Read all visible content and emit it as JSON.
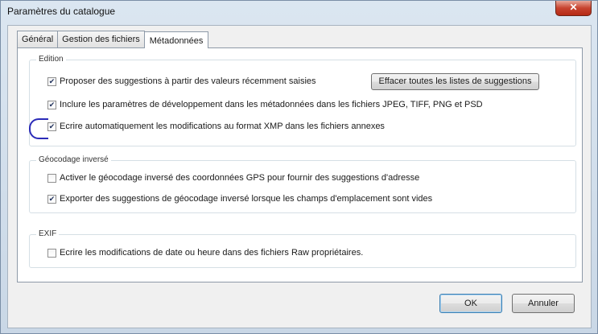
{
  "window": {
    "title": "Paramètres du catalogue",
    "close_label": "✕"
  },
  "tabs": [
    {
      "label": "Général"
    },
    {
      "label": "Gestion des fichiers"
    },
    {
      "label": "Métadonnées"
    }
  ],
  "sections": {
    "edition": {
      "legend": "Edition",
      "items": [
        {
          "label": "Proposer des suggestions à partir des valeurs récemment saisies",
          "checked": true
        },
        {
          "label": "Inclure les paramètres de développement dans les métadonnées dans les fichiers JPEG, TIFF, PNG et PSD",
          "checked": true
        },
        {
          "label": "Ecrire automatiquement les modifications au format XMP dans les fichiers annexes",
          "checked": true
        }
      ],
      "clear_button": "Effacer toutes les listes de suggestions"
    },
    "geocoding": {
      "legend": "Géocodage inversé",
      "items": [
        {
          "label": "Activer le géocodage inversé des coordonnées GPS pour fournir des suggestions d'adresse",
          "checked": false
        },
        {
          "label": "Exporter des suggestions de géocodage inversé lorsque les champs d'emplacement sont vides",
          "checked": true
        }
      ]
    },
    "exif": {
      "legend": "EXIF",
      "items": [
        {
          "label": "Ecrire les modifications de date ou heure dans des fichiers Raw propriétaires.",
          "checked": false
        }
      ]
    }
  },
  "footer": {
    "ok_label": "OK",
    "cancel_label": "Annuler"
  },
  "colors": {
    "annotation": "#2b2bb8",
    "close": "#c7432f"
  }
}
